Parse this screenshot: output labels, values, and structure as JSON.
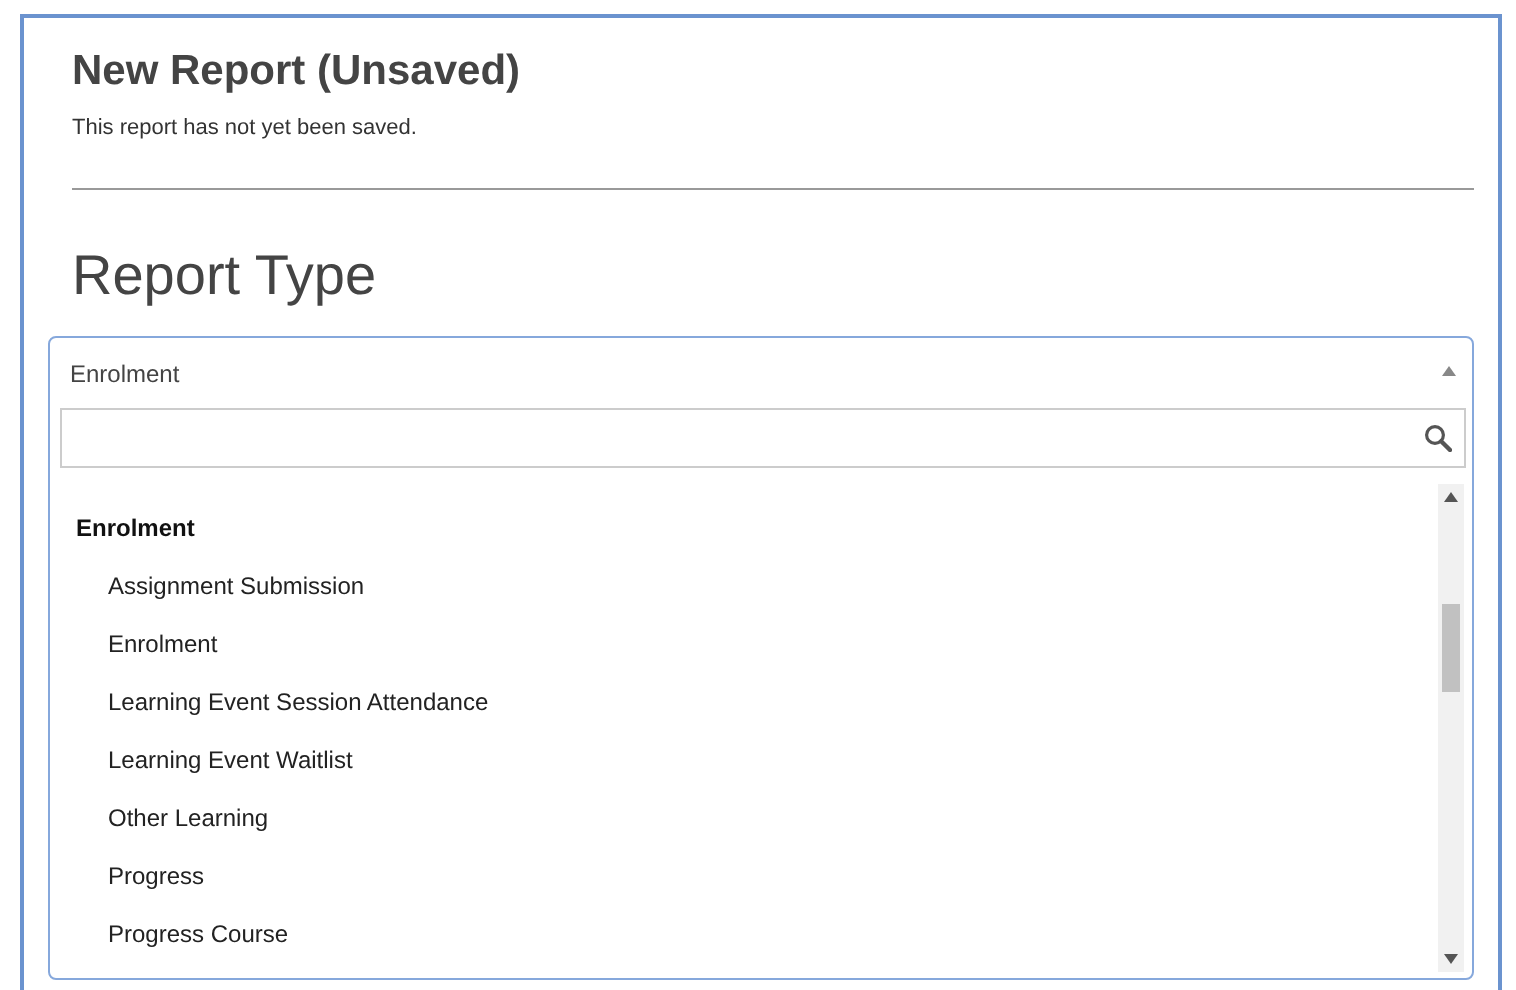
{
  "header": {
    "title": "New Report (Unsaved)",
    "subtitle": "This report has not yet been saved."
  },
  "section": {
    "title": "Report Type"
  },
  "select": {
    "value": "Enrolment",
    "expanded": true,
    "groups": [
      {
        "label": "Enrolment",
        "children": [
          {
            "label": "Assignment Submission"
          },
          {
            "label": "Enrolment"
          },
          {
            "label": "Learning Event Session Attendance"
          },
          {
            "label": "Learning Event Waitlist"
          },
          {
            "label": "Other Learning"
          },
          {
            "label": "Progress"
          },
          {
            "label": "Progress Course"
          }
        ]
      }
    ]
  }
}
